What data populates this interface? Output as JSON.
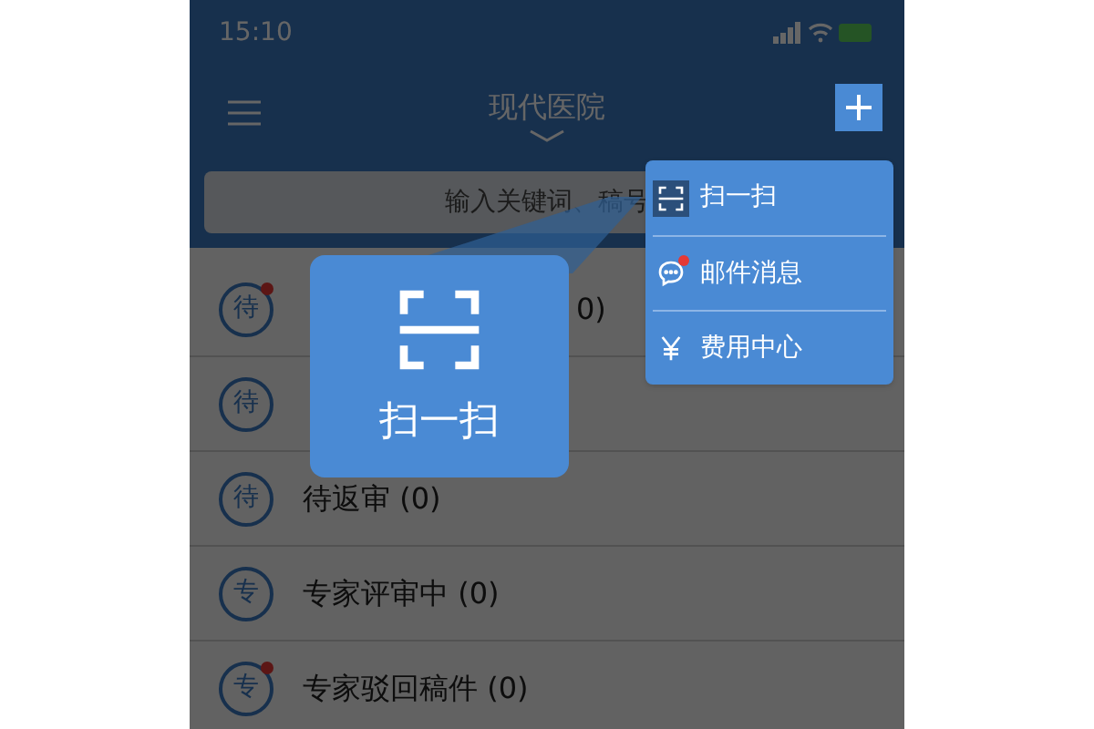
{
  "status_bar": {
    "time": "15:10"
  },
  "nav": {
    "title": "现代医院"
  },
  "search": {
    "placeholder": "输入关键词、稿号"
  },
  "rows": [
    {
      "badge": "待",
      "label": "0)",
      "unread": true
    },
    {
      "badge": "待",
      "unread": false
    },
    {
      "badge": "待",
      "label": "待返审 (0)",
      "unread": false
    },
    {
      "badge": "专",
      "label": "专家评审中 (0)",
      "unread": false
    },
    {
      "badge": "专",
      "label": "专家驳回稿件 (0)",
      "unread": true
    }
  ],
  "menu": {
    "items": [
      {
        "kind": "scan",
        "label": "扫一扫",
        "highlighted": true,
        "unread": false
      },
      {
        "kind": "mail",
        "label": "邮件消息",
        "highlighted": false,
        "unread": true
      },
      {
        "kind": "fee",
        "label": "费用中心",
        "highlighted": false,
        "unread": false
      }
    ]
  },
  "callout": {
    "label": "扫一扫"
  }
}
